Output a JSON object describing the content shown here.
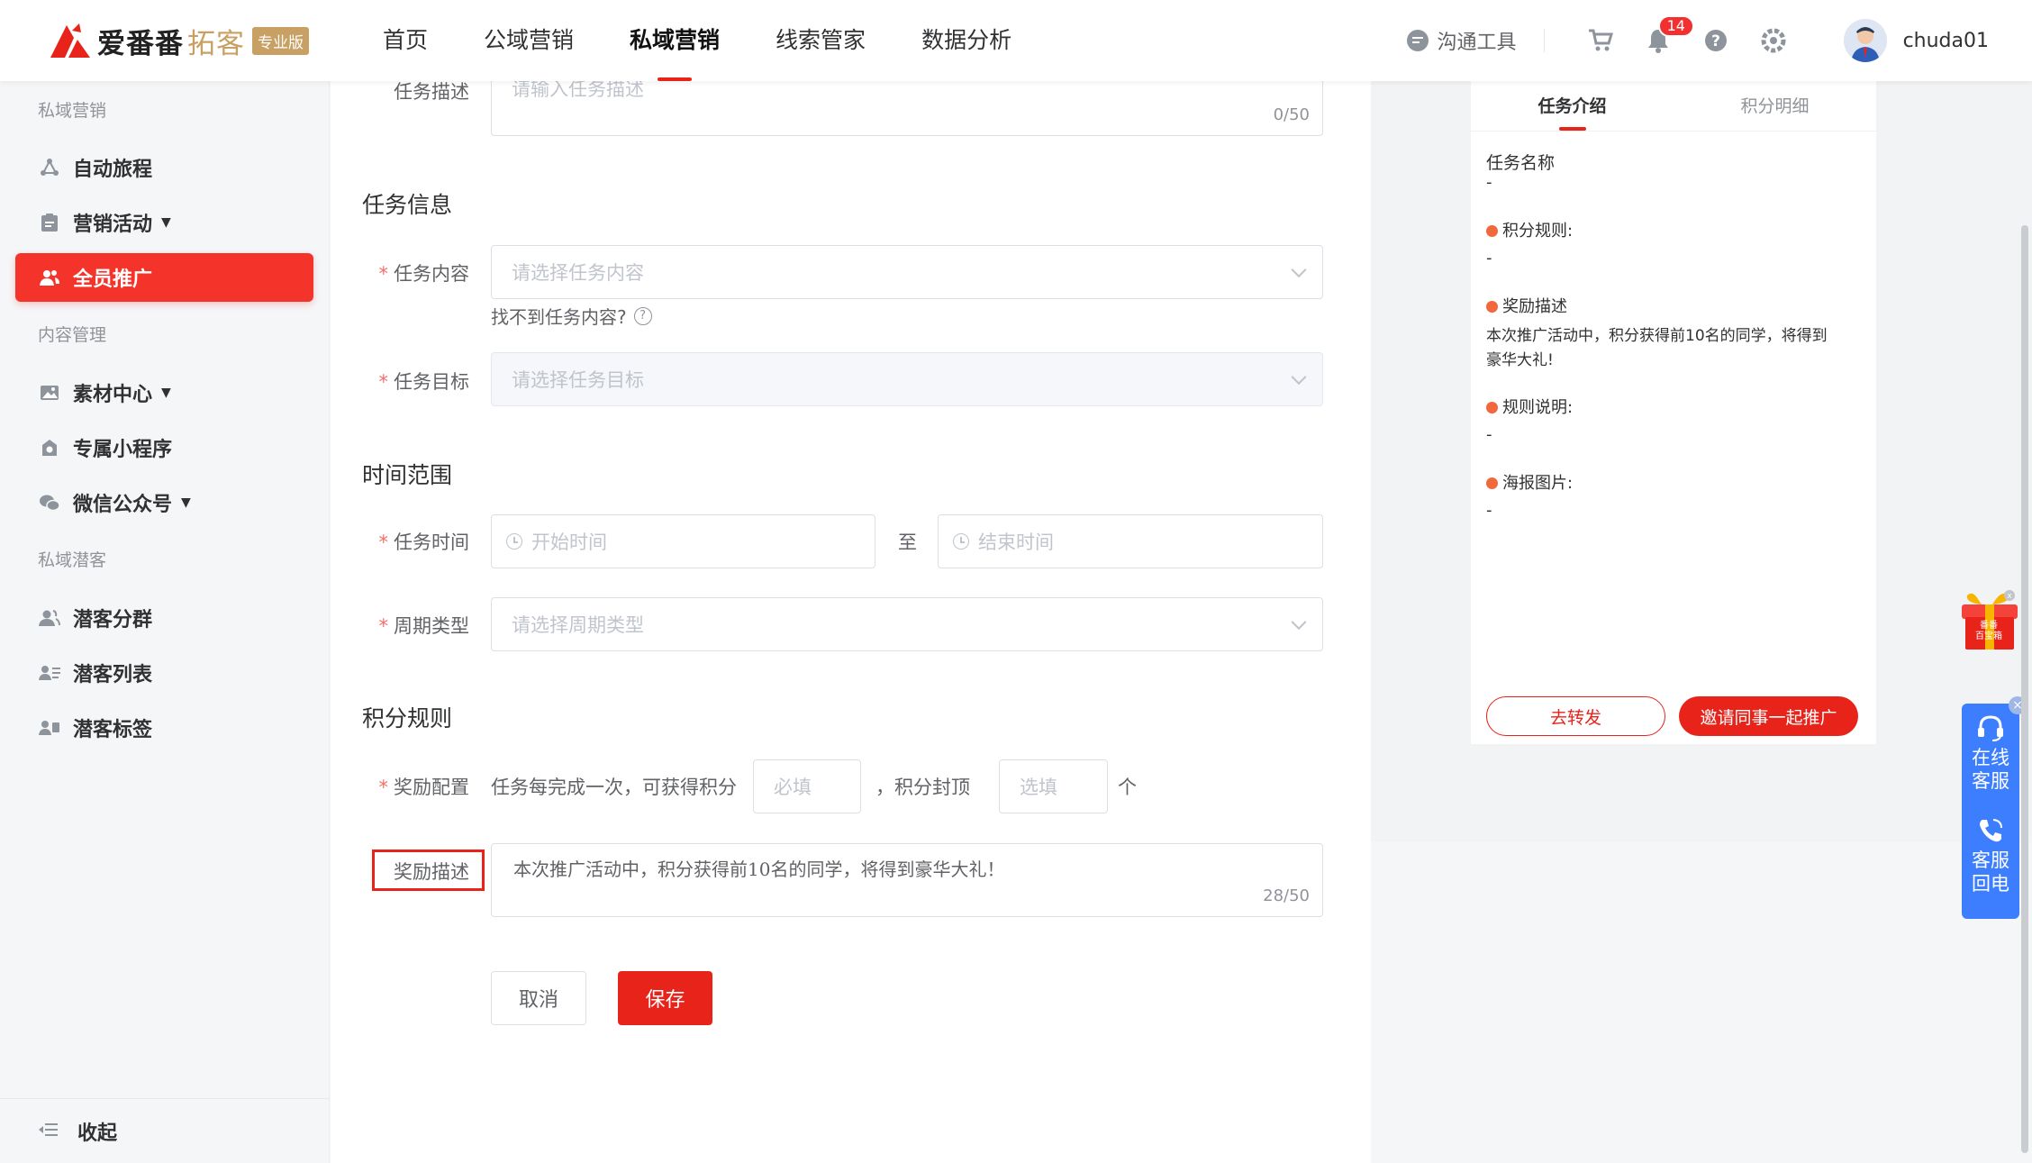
{
  "header": {
    "logo_main": "爱番番",
    "logo_sub": "拓客",
    "logo_badge": "专业版",
    "nav": [
      "首页",
      "公域营销",
      "私域营销",
      "线索管家",
      "数据分析"
    ],
    "tools_label": "沟通工具",
    "notification_count": "14",
    "username": "chuda01"
  },
  "sidebar": {
    "groups": [
      {
        "title": "私域营销",
        "items": [
          "自动旅程",
          "营销活动",
          "全员推广"
        ]
      },
      {
        "title": "内容管理",
        "items": [
          "素材中心",
          "专属小程序",
          "微信公众号"
        ]
      },
      {
        "title": "私域潜客",
        "items": [
          "潜客分群",
          "潜客列表",
          "潜客标签"
        ]
      }
    ],
    "collapse_label": "收起"
  },
  "form": {
    "desc_label": "任务描述",
    "desc_placeholder": "请输入任务描述",
    "desc_counter": "0/50",
    "section_task_info": "任务信息",
    "content_label": "任务内容",
    "content_placeholder": "请选择任务内容",
    "content_help": "找不到任务内容?",
    "target_label": "任务目标",
    "target_placeholder": "请选择任务目标",
    "section_time": "时间范围",
    "time_label": "任务时间",
    "start_placeholder": "开始时间",
    "to_label": "至",
    "end_placeholder": "结束时间",
    "cycle_label": "周期类型",
    "cycle_placeholder": "请选择周期类型",
    "section_points": "积分规则",
    "reward_label": "奖励配置",
    "reward_text1": "任务每完成一次，可获得积分",
    "reward_placeholder1": "必填",
    "reward_text2": "，积分封顶",
    "reward_placeholder2": "选填",
    "reward_unit": "个",
    "reward_desc_label": "奖励描述",
    "reward_desc_value": "本次推广活动中，积分获得前10名的同学，将得到豪华大礼！",
    "reward_desc_counter": "28/50",
    "cancel_label": "取消",
    "save_label": "保存"
  },
  "preview": {
    "tabs": [
      "任务介绍",
      "积分明细"
    ],
    "task_name_label": "任务名称",
    "task_name_value": "-",
    "rule_label": "积分规则:",
    "rule_value": "-",
    "reward_label": "奖励描述",
    "reward_value_line1": "本次推广活动中，积分获得前10名的同学，将得到",
    "reward_value_line2": "豪华大礼!",
    "explain_label": "规则说明:",
    "explain_value": "-",
    "poster_label": "海报图片:",
    "poster_value": "-",
    "forward_btn": "去转发",
    "invite_btn": "邀请同事一起推广"
  },
  "widgets": {
    "gift_line1": "番番",
    "gift_line2": "百宝箱",
    "cs_online": [
      "在线",
      "客服"
    ],
    "cs_callback": [
      "客服",
      "回电"
    ]
  },
  "colors": {
    "accent": "#e8231a",
    "brand_gold": "#c8a063",
    "cs_blue": "#3d7eff"
  }
}
